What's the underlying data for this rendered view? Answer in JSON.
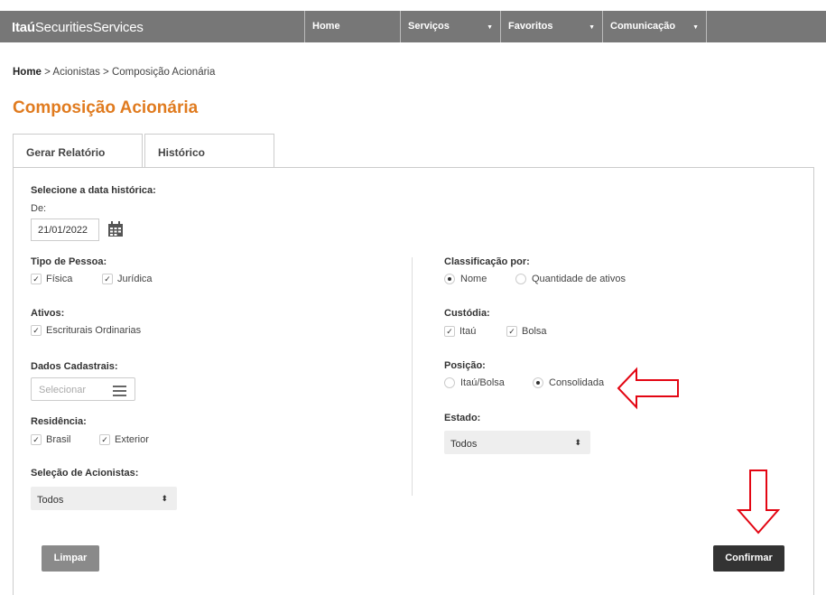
{
  "header": {
    "brand_bold": "Itaú",
    "brand_rest": "SecuritiesServices",
    "nav": [
      {
        "label": "Home"
      },
      {
        "label": "Serviços"
      },
      {
        "label": "Favoritos"
      },
      {
        "label": "Comunicação"
      }
    ]
  },
  "breadcrumb": {
    "home": "Home",
    "rest": " > Acionistas > Composição Acionária"
  },
  "page_title": "Composição Acionária",
  "tabs": [
    {
      "label": "Gerar Relatório",
      "active": true
    },
    {
      "label": "Histórico",
      "active": false
    }
  ],
  "form": {
    "date_section_label": "Selecione a data histórica:",
    "date_from_label": "De:",
    "date_value": "21/01/2022",
    "tipo_pessoa": {
      "label": "Tipo de Pessoa:",
      "options": [
        {
          "label": "Física",
          "checked": true
        },
        {
          "label": "Jurídica",
          "checked": true
        }
      ]
    },
    "ativos": {
      "label": "Ativos:",
      "options": [
        {
          "label": "Escriturais Ordinarias",
          "checked": true
        }
      ]
    },
    "dados_cadastrais": {
      "label": "Dados Cadastrais:",
      "placeholder": "Selecionar"
    },
    "residencia": {
      "label": "Residência:",
      "options": [
        {
          "label": "Brasil",
          "checked": true
        },
        {
          "label": "Exterior",
          "checked": true
        }
      ]
    },
    "selecao_acionistas": {
      "label": "Seleção de Acionistas:",
      "value": "Todos"
    },
    "classificacao": {
      "label": "Classificação por:",
      "options": [
        {
          "label": "Nome",
          "selected": true
        },
        {
          "label": "Quantidade de ativos",
          "selected": false
        }
      ]
    },
    "custodia": {
      "label": "Custódia:",
      "options": [
        {
          "label": "Itaú",
          "checked": true
        },
        {
          "label": "Bolsa",
          "checked": true
        }
      ]
    },
    "posicao": {
      "label": "Posição:",
      "options": [
        {
          "label": "Itaú/Bolsa",
          "selected": false
        },
        {
          "label": "Consolidada",
          "selected": true
        }
      ]
    },
    "estado": {
      "label": "Estado:",
      "value": "Todos"
    }
  },
  "buttons": {
    "clear": "Limpar",
    "confirm": "Confirmar"
  },
  "icons": {
    "check": "✓",
    "select_arrow": "⬍",
    "caret": "▼"
  },
  "colors": {
    "accent": "#e07b1f",
    "annotation_arrow": "#e30613",
    "topbar": "#777777"
  }
}
